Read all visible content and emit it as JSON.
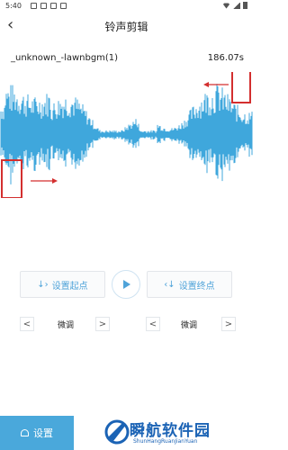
{
  "status_bar": {
    "time": "5:40"
  },
  "header": {
    "back_icon": "chevron-left-icon",
    "title": "铃声剪辑"
  },
  "file": {
    "name": "_unknown_-lawnbgm(1)",
    "duration": "186.07s"
  },
  "waveform": {
    "color": "#3fa7dc",
    "marker_color": "#d32f2f",
    "start_fraction": 0.0,
    "end_fraction": 1.0
  },
  "controls": {
    "set_start_label": "设置起点",
    "set_end_label": "设置终点",
    "play_icon": "play-icon"
  },
  "finetune": {
    "left": {
      "label": "微调",
      "prev": "<",
      "next": ">"
    },
    "right": {
      "label": "微调",
      "prev": "<",
      "next": ">"
    }
  },
  "footer": {
    "settings_label": "设置",
    "watermark_main": "瞬航软件园",
    "watermark_sub": "ShunHangRuanJianYuan"
  },
  "colors": {
    "accent": "#4aa8db",
    "watermark": "#1b63b5"
  }
}
